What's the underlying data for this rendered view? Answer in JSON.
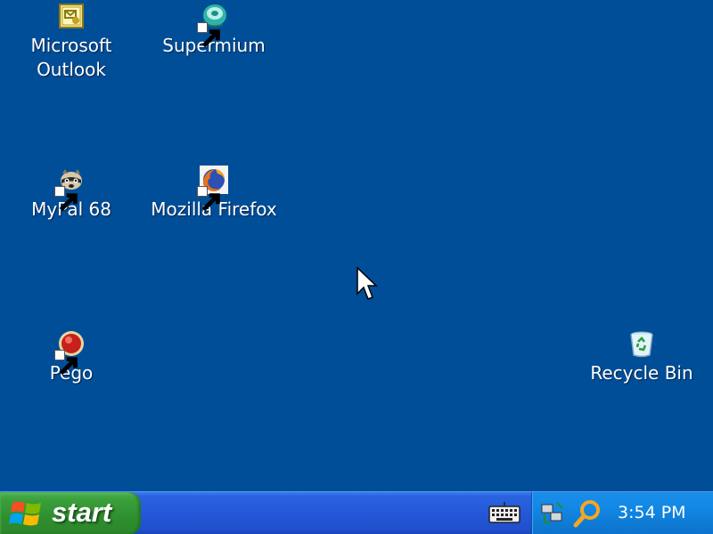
{
  "desktop": {
    "background_color": "#004e98",
    "icons": [
      {
        "name": "Microsoft\nOutlook",
        "icon": "outlook-icon",
        "shortcut": false
      },
      {
        "name": "Supermium",
        "icon": "supermium-icon",
        "shortcut": true
      },
      {
        "name": "MyPal 68",
        "icon": "mypal-icon",
        "shortcut": true
      },
      {
        "name": "Mozilla Firefox",
        "icon": "firefox-icon",
        "shortcut": true
      },
      {
        "name": "Pego",
        "icon": "pego-icon",
        "shortcut": true
      },
      {
        "name": "Recycle Bin",
        "icon": "recycle-bin-icon",
        "shortcut": false
      }
    ]
  },
  "taskbar": {
    "start_label": "start",
    "start_color": "#3a9e3a",
    "bar_color": "#2458d8",
    "tray": {
      "color": "#138ae6",
      "icons": [
        "network-icon",
        "search-icon"
      ],
      "clock": "3:54 PM"
    },
    "keyboard_icon": "keyboard-icon"
  }
}
